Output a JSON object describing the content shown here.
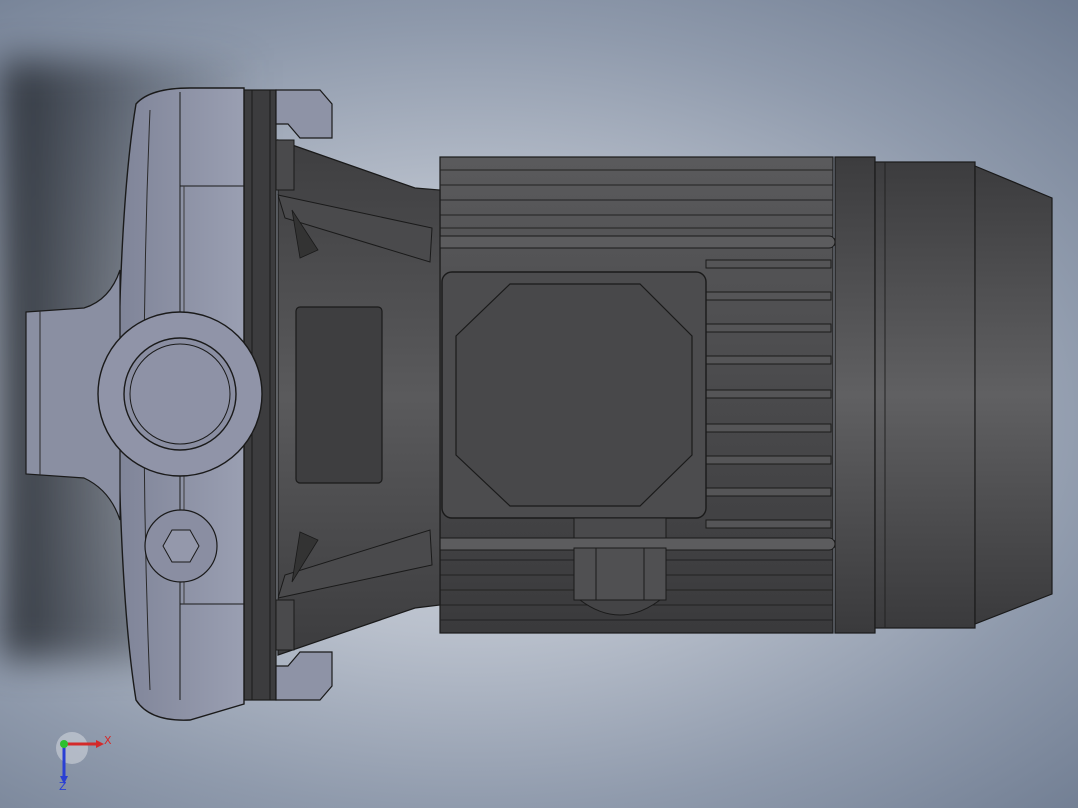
{
  "viewport": {
    "model": "centrifugal-pump-motor-assembly",
    "colors": {
      "background_light": "#dde1e8",
      "background_dark": "#6f7c91",
      "pump_housing": "#8e93a6",
      "motor_body": "#4a4a4c",
      "outline": "#1a1a1a"
    }
  },
  "triad": {
    "x_label": "X",
    "z_label": "Z",
    "x_color": "#d42a2a",
    "y_color": "#2ec02e",
    "z_color": "#2a3fd4"
  }
}
